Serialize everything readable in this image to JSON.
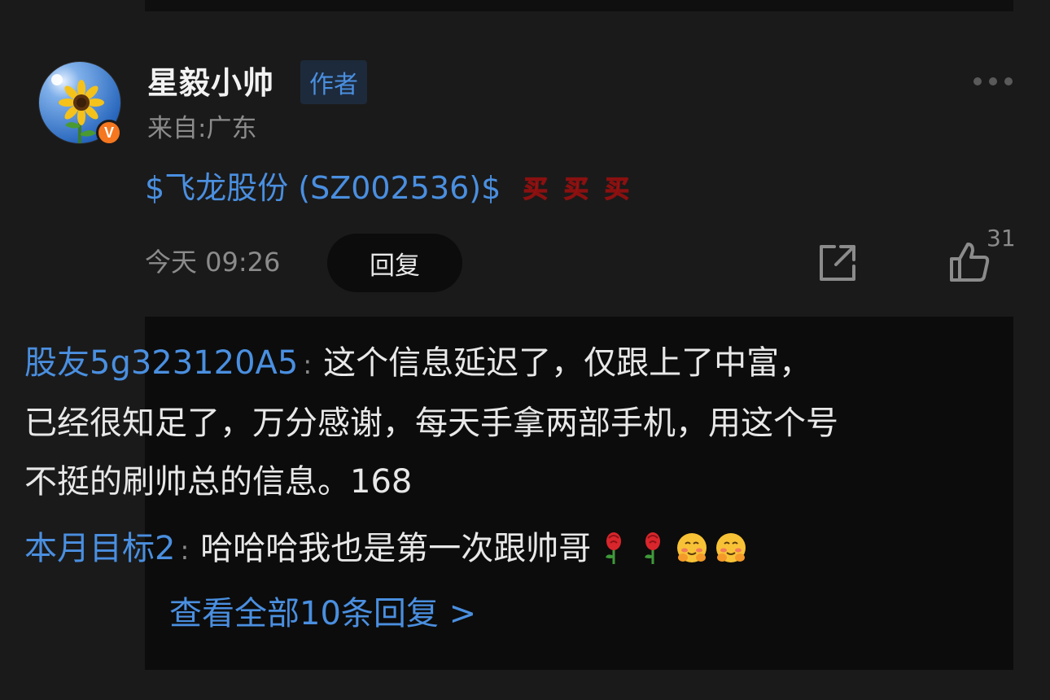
{
  "post": {
    "username": "星毅小帅",
    "author_tag": "作者",
    "location": "来自:广东",
    "stock_mention": "$飞龙股份 (SZ002536)$",
    "buy_emoji_count": 3,
    "buy_emoji_name": "买",
    "time": "今天 09:26",
    "reply_label": "回复",
    "like_count": "31",
    "verified_badge": "V"
  },
  "replies": [
    {
      "author": "股友5g323120A5",
      "colon": ":",
      "text": "这个信息延迟了，仅跟上了中富，已经很知足了，万分感谢，每天手拿两部手机，用这个号不挺的刷帅总的信息。168"
    },
    {
      "author": "本月目标2",
      "colon": ":",
      "text": "哈哈哈我也是第一次跟帅哥",
      "emojis": [
        "rose-icon",
        "rose-icon",
        "blushing-hug-icon",
        "blushing-hug-icon"
      ]
    }
  ],
  "view_all": "查看全部10条回复 >",
  "colors": {
    "background": "#1a1a1a",
    "link_blue": "#4a8fe0",
    "muted_gray": "#8b8b8b",
    "reply_box": "#0c0c0c",
    "badge_orange": "#f5771f"
  }
}
